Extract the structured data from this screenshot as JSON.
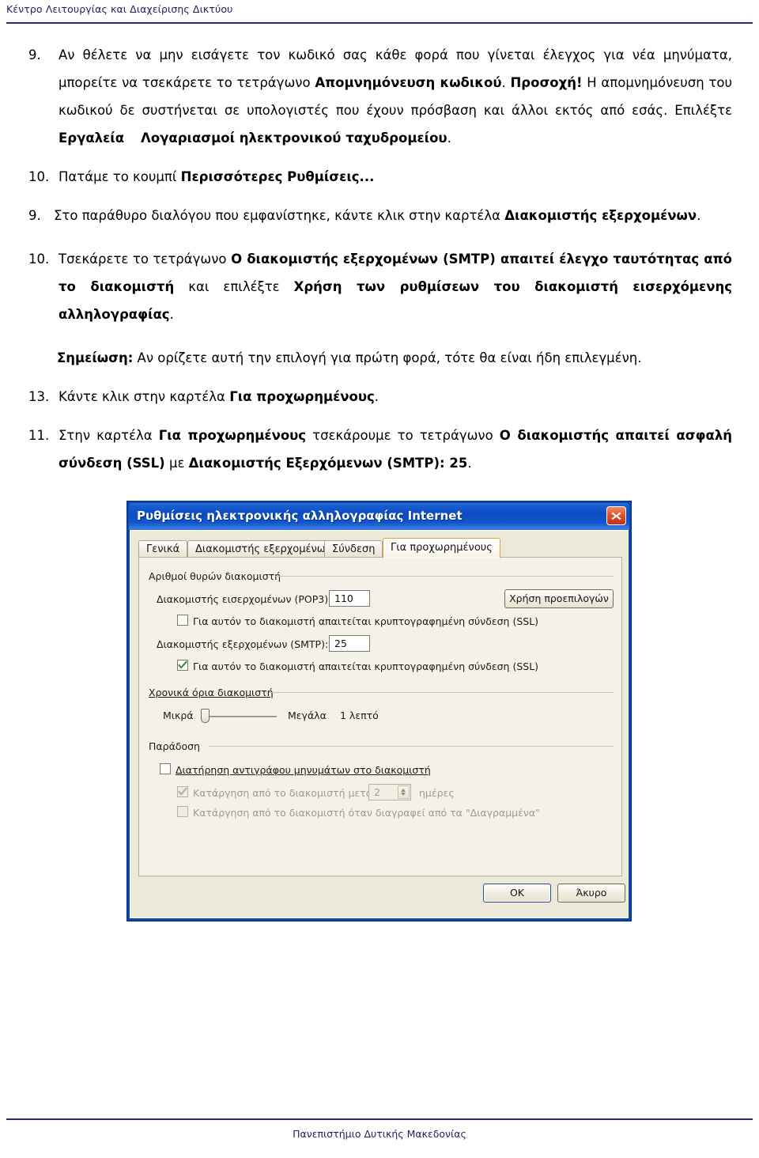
{
  "page": {
    "header": "Κέντρο Λειτουργίας και Διαχείρισης Δικτύου",
    "footer": "Πανεπιστήμιο Δυτικής Μακεδονίας"
  },
  "steps": {
    "s9a": {
      "num": "9.",
      "t1": "Αν θέλετε να μην εισάγετε τον κωδικό σας κάθε φορά που γίνεται έλεγχος για νέα μηνύματα, μπορείτε να τσεκάρετε το τετράγωνο ",
      "b1": "Απομνημόνευση κωδικού",
      "t2": ". ",
      "b2": "Προσοχή!",
      "t3": " Η απομνημόνευση του κωδικού δε συστήνεται σε υπολογιστές που έχουν πρόσβαση και άλλοι εκτός από εσάς. Επιλέξτε ",
      "b3": "Εργαλεία",
      "t4": "    ",
      "b4": "Λογαριασμοί ηλεκτρονικού ταχυδρομείου",
      "t5": "."
    },
    "s10a": {
      "num": "10.",
      "t1": "Πατάμε το κουμπί ",
      "b1": "Περισσότερες Ρυθμίσεις...",
      "t2": ""
    },
    "s9b": {
      "num": "9.",
      "t1": "Στο παράθυρο διαλόγου που εμφανίστηκε, κάντε κλικ στην καρτέλα ",
      "b1": "Διακομιστής εξερχομένων",
      "t2": "."
    },
    "s10b": {
      "num": "10.",
      "t1": "Τσεκάρετε το τετράγωνο ",
      "b1": "Ο διακομιστής εξερχομένων (SMTP) απαιτεί έλεγχο ταυτότητας από το διακομιστή",
      "t2": " και επιλέξτε ",
      "b2": "Χρήση των ρυθμίσεων του διακομιστή εισερχόμενης αλληλογραφίας",
      "t3": "."
    },
    "note": {
      "b1": "Σημείωση:",
      "t1": " Αν ορίζετε αυτή την επιλογή για πρώτη φορά, τότε θα είναι ήδη επιλεγμένη."
    },
    "s13": {
      "num": "13.",
      "t1": "Κάντε κλικ στην καρτέλα ",
      "b1": "Για προχωρημένους",
      "t2": "."
    },
    "s11": {
      "num": "11.",
      "t1": "Στην καρτέλα ",
      "b1": "Για προχωρημένους",
      "t2": " τσεκάρουμε το τετράγωνο ",
      "b2": "Ο διακομιστής απαιτεί ασφαλή σύνδεση (SSL)",
      "t3": " με ",
      "b3": "Διακομιστής Εξερχόμενων (SMTP): 25",
      "t4": "."
    }
  },
  "dialog": {
    "title": "Ρυθμίσεις ηλεκτρονικής αλληλογραφίας Internet",
    "close_icon": "close-icon",
    "tabs": [
      {
        "label": "Γενικά",
        "active": false
      },
      {
        "label": "Διακομιστής εξερχομένων",
        "active": false
      },
      {
        "label": "Σύνδεση",
        "active": false
      },
      {
        "label": "Για προχωρημένους",
        "active": true
      }
    ],
    "groups": {
      "ports": "Αριθμοί θυρών διακομιστή",
      "timeouts": "Χρονικά όρια διακομιστή",
      "delivery": "Παράδοση"
    },
    "ports": {
      "pop3_label": "Διακομιστής εισερχομένων (POP3):",
      "pop3_value": "110",
      "pop3_ssl_label": "Για αυτόν το διακομιστή απαιτείται κρυπτογραφημένη σύνδεση (SSL)",
      "pop3_ssl_checked": false,
      "smtp_label": "Διακομιστής εξερχομένων (SMTP):",
      "smtp_value": "25",
      "smtp_ssl_label": "Για αυτόν το διακομιστή απαιτείται κρυπτογραφημένη σύνδεση (SSL)",
      "smtp_ssl_checked": true,
      "defaults_button": "Χρήση προεπιλογών"
    },
    "timeouts": {
      "short_label": "Μικρά",
      "long_label": "Μεγάλα",
      "value_label": "1 λεπτό"
    },
    "delivery": {
      "keep_copy_label": "Διατήρηση αντιγράφου μηνυμάτων στο διακομιστή",
      "keep_copy_checked": false,
      "remove_after_label": "Κατάργηση από το διακομιστή μετά από",
      "remove_after_checked": true,
      "remove_after_days": "2",
      "days_label": "ημέρες",
      "remove_deleted_label": "Κατάργηση από το διακομιστή όταν διαγραφεί από τα \"Διαγραμμένα\"",
      "remove_deleted_checked": false
    },
    "buttons": {
      "ok": "OK",
      "cancel": "Άκυρο"
    }
  },
  "colors": {
    "title_bar": "#0c4cc4",
    "dialog_face": "#ece9d8",
    "tab_active_border": "#d9a441",
    "rule": "#2b2b7a",
    "check_green": "#2f8a2f",
    "close_red": "#c0321a"
  }
}
